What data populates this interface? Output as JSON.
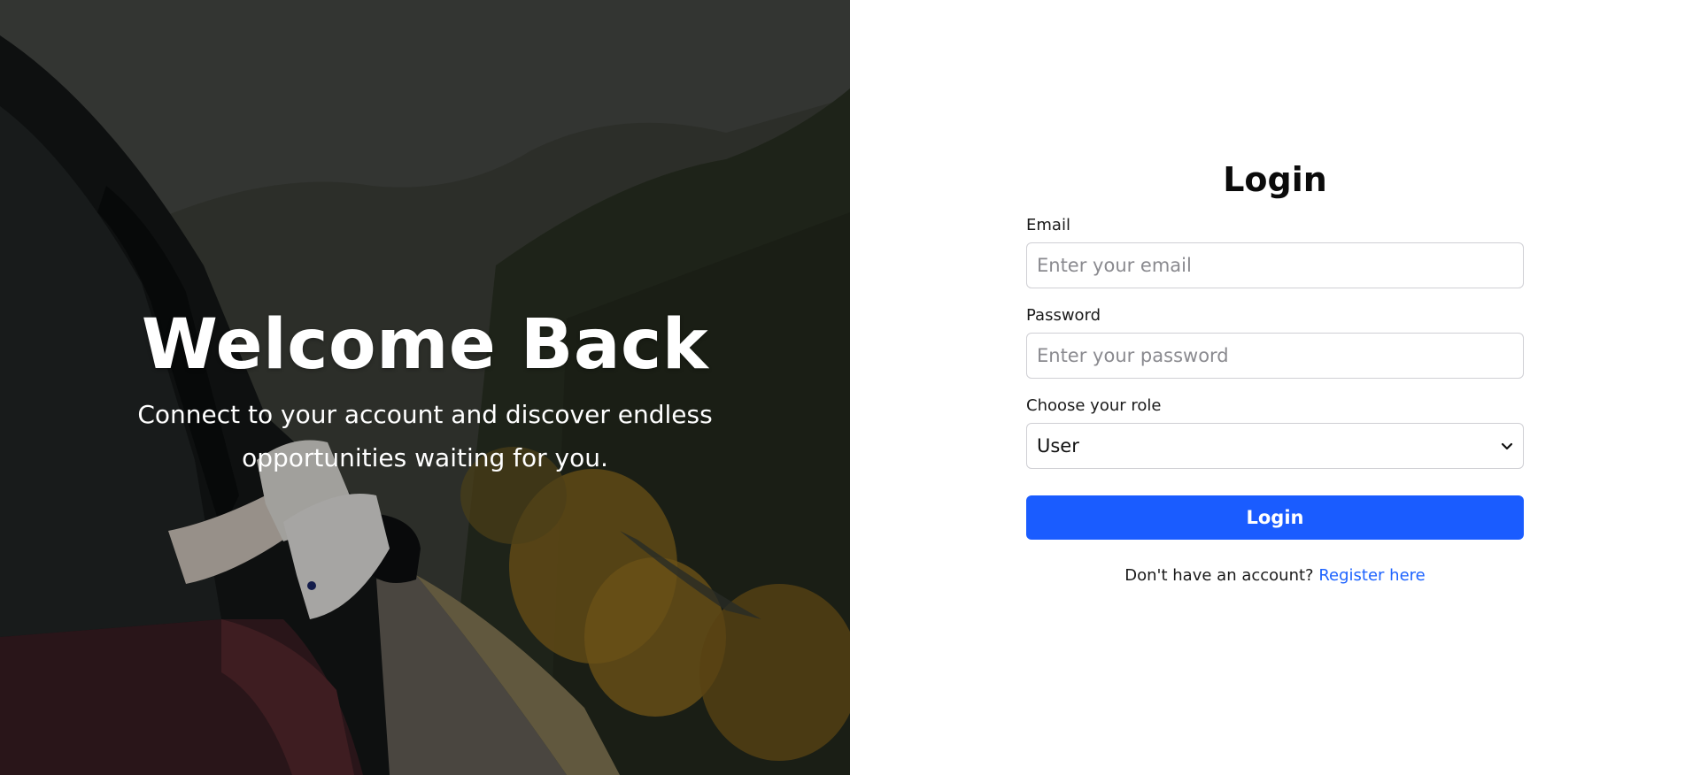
{
  "hero": {
    "title": "Welcome Back",
    "subtitle": "Connect to your account and discover endless opportunities waiting for you."
  },
  "login": {
    "heading": "Login",
    "email": {
      "label": "Email",
      "placeholder": "Enter your email"
    },
    "password": {
      "label": "Password",
      "placeholder": "Enter your password"
    },
    "role": {
      "label": "Choose your role",
      "selected": "User"
    },
    "submit_label": "Login",
    "register_prompt": "Don't have an account?",
    "register_link": "Register here"
  },
  "colors": {
    "primary": "#1a5cff",
    "link": "#1d63ff",
    "text": "#0b0b0b",
    "border": "#cfcfd4"
  },
  "icons": [
    "chevron-down-icon"
  ]
}
